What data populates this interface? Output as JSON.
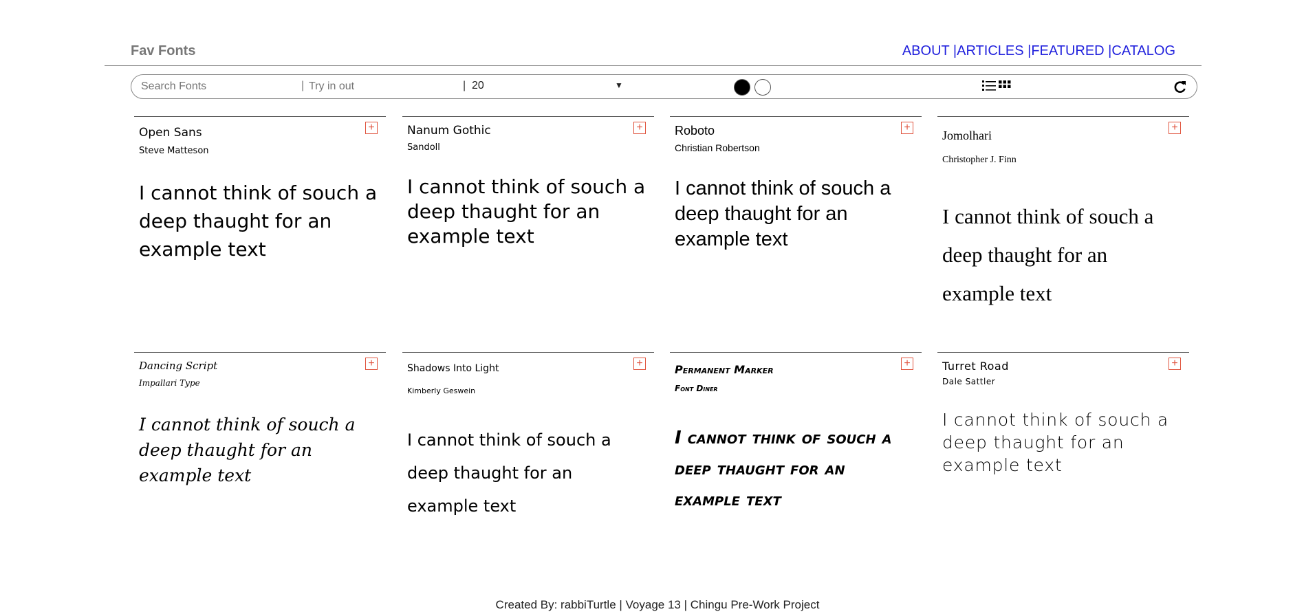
{
  "header": {
    "brand": "Fav Fonts",
    "nav": [
      "ABOUT |",
      "ARTICLES |",
      "FEATURED |",
      "CATALOG"
    ]
  },
  "toolbar": {
    "search_placeholder": "Search Fonts",
    "sep": "|",
    "try_placeholder": "Try in out",
    "size_value": "20",
    "caret": "▼"
  },
  "cards": [
    {
      "font": "Open Sans",
      "designer": "Steve Matteson",
      "sample": "I cannot think of souch a deep thaught for an example text"
    },
    {
      "font": "Nanum Gothic",
      "designer": "Sandoll",
      "sample": "I cannot think of souch a deep thaught for an example text"
    },
    {
      "font": "Roboto",
      "designer": "Christian Robertson",
      "sample": "I cannot think of souch a deep thaught for an example text"
    },
    {
      "font": "Jomolhari",
      "designer": "Christopher J. Finn",
      "sample": "I cannot think of souch a deep thaught for an example text"
    },
    {
      "font": "Dancing Script",
      "designer": "Impallari Type",
      "sample": "I cannot think of souch a deep thaught for an example text"
    },
    {
      "font": "Shadows Into Light",
      "designer": "Kimberly Geswein",
      "sample": "I cannot think of souch a deep thaught for an example text"
    },
    {
      "font": "Permanent Marker",
      "designer": "Font Diner",
      "sample": "I cannot think of souch a deep thaught for an example text"
    },
    {
      "font": "Turret Road",
      "designer": "Dale Sattler",
      "sample": "I cannot think of souch a deep thaught for an example text"
    }
  ],
  "add_glyph": "+",
  "footer": "Created By: rabbiTurtle | Voyage 13 | Chingu Pre-Work Project",
  "icons": {
    "theme_dark": "dark-theme-icon",
    "theme_light": "light-theme-icon",
    "list_view": "list-view-icon",
    "grid_view": "grid-view-icon",
    "refresh": "refresh-icon",
    "add": "add-icon"
  },
  "colors": {
    "nav_link": "#2222dd",
    "add_button": "#e0533d",
    "brand": "#777777"
  }
}
